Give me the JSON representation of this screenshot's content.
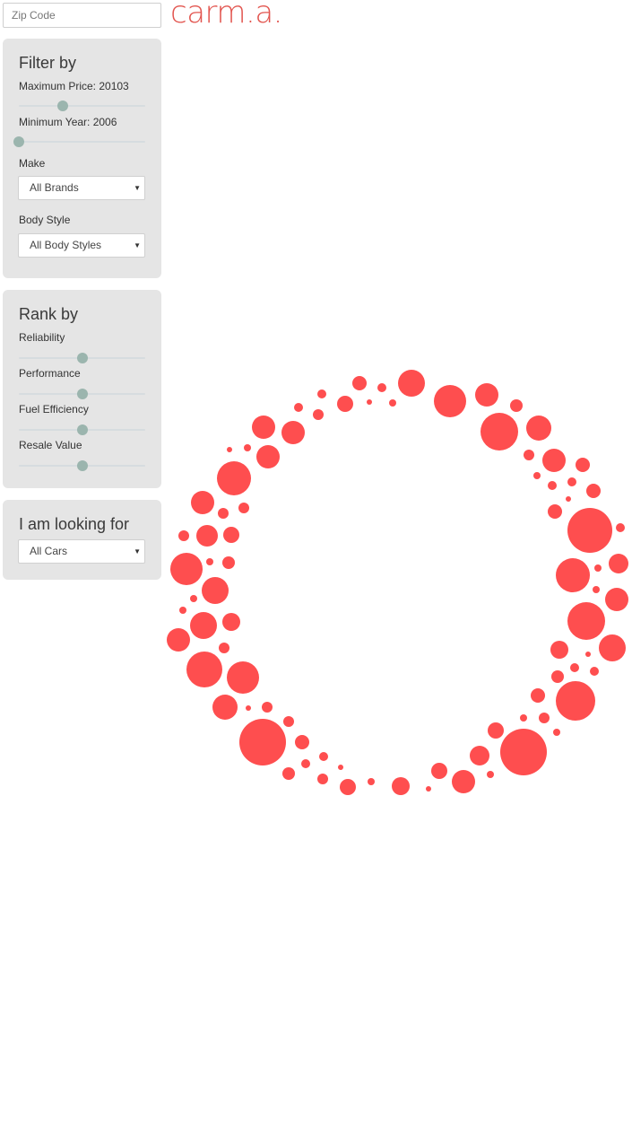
{
  "search": {
    "zip_placeholder": "Zip Code",
    "zip_value": ""
  },
  "brand": {
    "logo_text": "carm.a."
  },
  "filter": {
    "title": "Filter by",
    "max_price_label": "Maximum Price: 20103",
    "max_price_value": 0.35,
    "min_year_label": "Minimum Year: 2006",
    "min_year_value": 0.0,
    "make_label": "Make",
    "make_selected": "All Brands",
    "body_label": "Body Style",
    "body_selected": "All Body Styles"
  },
  "rank": {
    "title": "Rank by",
    "items": [
      {
        "label": "Reliability",
        "value": 0.5
      },
      {
        "label": "Performance",
        "value": 0.5
      },
      {
        "label": "Fuel Efficiency",
        "value": 0.5
      },
      {
        "label": "Resale Value",
        "value": 0.5
      }
    ]
  },
  "looking": {
    "title": "I am looking for",
    "selected": "All Cars"
  },
  "colors": {
    "accent": "#e2554f",
    "bubble": "#fe4e4f",
    "panel_bg": "#e5e5e5",
    "slider_thumb": "#9bb5ae",
    "slider_track": "#d6dcdf"
  },
  "icons": {
    "select_caret": "caret-down-icon"
  }
}
